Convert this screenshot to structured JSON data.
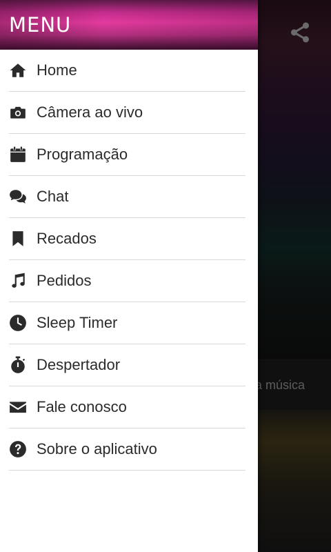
{
  "drawer": {
    "title": "MENU",
    "items": [
      {
        "label": "Home",
        "icon": "home-icon"
      },
      {
        "label": "Câmera ao vivo",
        "icon": "camera-icon"
      },
      {
        "label": "Programação",
        "icon": "calendar-icon"
      },
      {
        "label": "Chat",
        "icon": "chat-icon"
      },
      {
        "label": "Recados",
        "icon": "bookmark-icon"
      },
      {
        "label": "Pedidos",
        "icon": "music-note-icon"
      },
      {
        "label": "Sleep Timer",
        "icon": "clock-icon"
      },
      {
        "label": "Despertador",
        "icon": "stopwatch-icon"
      },
      {
        "label": "Fale conosco",
        "icon": "envelope-icon"
      },
      {
        "label": "Sobre o aplicativo",
        "icon": "question-icon"
      }
    ]
  },
  "background": {
    "share_icon": "share-icon",
    "now_playing_text": "a música"
  },
  "colors": {
    "header_accent": "#e43a9f",
    "text": "#2b2b2b",
    "divider": "#d8d8d8"
  }
}
